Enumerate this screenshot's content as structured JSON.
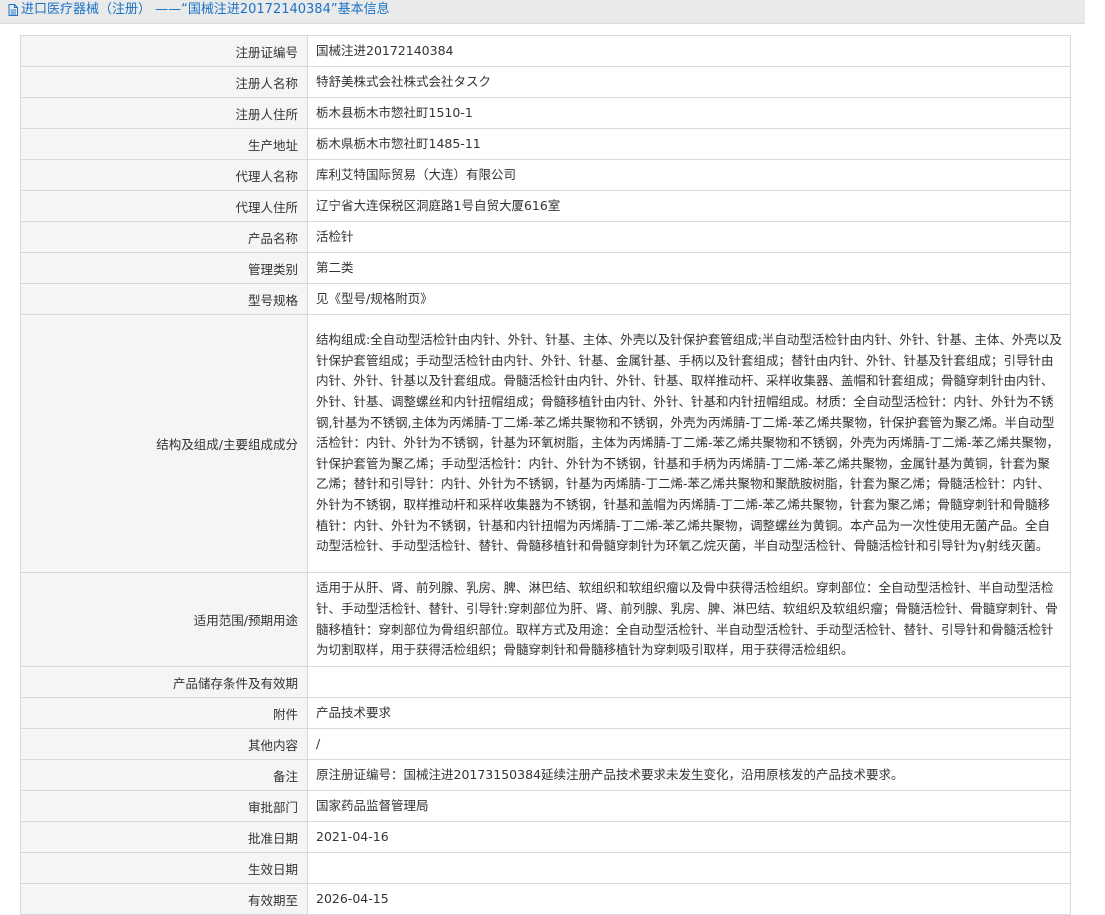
{
  "header": {
    "title": "进口医疗器械（注册） ——“国械注进20172140384”基本信息",
    "icon": "document-icon"
  },
  "rows": [
    {
      "label": "注册证编号",
      "value": "国械注进20172140384"
    },
    {
      "label": "注册人名称",
      "value": "特舒美株式会社株式会社タスク"
    },
    {
      "label": "注册人住所",
      "value": "栃木县栃木市惣社町1510-1"
    },
    {
      "label": "生产地址",
      "value": "栃木県栃木市惣社町1485-11"
    },
    {
      "label": "代理人名称",
      "value": "库利艾特国际贸易（大连）有限公司"
    },
    {
      "label": "代理人住所",
      "value": "辽宁省大连保税区洞庭路1号自贸大厦616室"
    },
    {
      "label": "产品名称",
      "value": "活检针"
    },
    {
      "label": "管理类别",
      "value": "第二类"
    },
    {
      "label": "型号规格",
      "value": "见《型号/规格附页》"
    },
    {
      "label": "结构及组成/主要组成成分",
      "value": "结构组成:全自动型活检针由内针、外针、针基、主体、外壳以及针保护套管组成;半自动型活检针由内针、外针、针基、主体、外壳以及针保护套管组成；手动型活检针由内针、外针、针基、金属针基、手柄以及针套组成；替针由内针、外针、针基及针套组成；引导针由内针、外针、针基以及针套组成。骨髓活检针由内针、外针、针基、取样推动杆、采样收集器、盖帽和针套组成；骨髓穿刺针由内针、外针、针基、调整螺丝和内针扭帽组成；骨髓移植针由内针、外针、针基和内针扭帽组成。材质：全自动型活检针：内针、外针为不锈钢,针基为不锈钢,主体为丙烯腈-丁二烯-苯乙烯共聚物和不锈钢，外壳为丙烯腈-丁二烯-苯乙烯共聚物，针保护套管为聚乙烯。半自动型活检针：内针、外针为不锈钢，针基为环氧树脂，主体为丙烯腈-丁二烯-苯乙烯共聚物和不锈钢，外壳为丙烯腈-丁二烯-苯乙烯共聚物，针保护套管为聚乙烯；手动型活检针：内针、外针为不锈钢，针基和手柄为丙烯腈-丁二烯-苯乙烯共聚物，金属针基为黄铜，针套为聚乙烯；替针和引导针：内针、外针为不锈钢，针基为丙烯腈-丁二烯-苯乙烯共聚物和聚酰胺树脂，针套为聚乙烯；骨髓活检针：内针、外针为不锈钢，取样推动杆和采样收集器为不锈钢，针基和盖帽为丙烯腈-丁二烯-苯乙烯共聚物，针套为聚乙烯；骨髓穿刺针和骨髓移植针：内针、外针为不锈钢，针基和内针扭帽为丙烯腈-丁二烯-苯乙烯共聚物，调整螺丝为黄铜。本产品为一次性使用无菌产品。全自动型活检针、手动型活检针、替针、骨髓移植针和骨髓穿刺针为环氧乙烷灭菌，半自动型活检针、骨髓活检针和引导针为γ射线灭菌。"
    },
    {
      "label": "适用范围/预期用途",
      "value": "适用于从肝、肾、前列腺、乳房、脾、淋巴结、软组织和软组织瘤以及骨中获得活检组织。穿刺部位：全自动型活检针、半自动型活检针、手动型活检针、替针、引导针:穿刺部位为肝、肾、前列腺、乳房、脾、淋巴结、软组织及软组织瘤；骨髓活检针、骨髓穿刺针、骨髓移植针：穿刺部位为骨组织部位。取样方式及用途：全自动型活检针、半自动型活检针、手动型活检针、替针、引导针和骨髓活检针为切割取样，用于获得活检组织；骨髓穿刺针和骨髓移植针为穿刺吸引取样，用于获得活检组织。"
    },
    {
      "label": "产品储存条件及有效期",
      "value": ""
    },
    {
      "label": "附件",
      "value": "产品技术要求"
    },
    {
      "label": "其他内容",
      "value": "/"
    },
    {
      "label": "备注",
      "value": "原注册证编号：国械注进20173150384延续注册产品技术要求未发生变化，沿用原核发的产品技术要求。"
    },
    {
      "label": "审批部门",
      "value": "国家药品监督管理局"
    },
    {
      "label": "批准日期",
      "value": "2021-04-16"
    },
    {
      "label": "生效日期",
      "value": ""
    },
    {
      "label": "有效期至",
      "value": "2026-04-15"
    }
  ]
}
